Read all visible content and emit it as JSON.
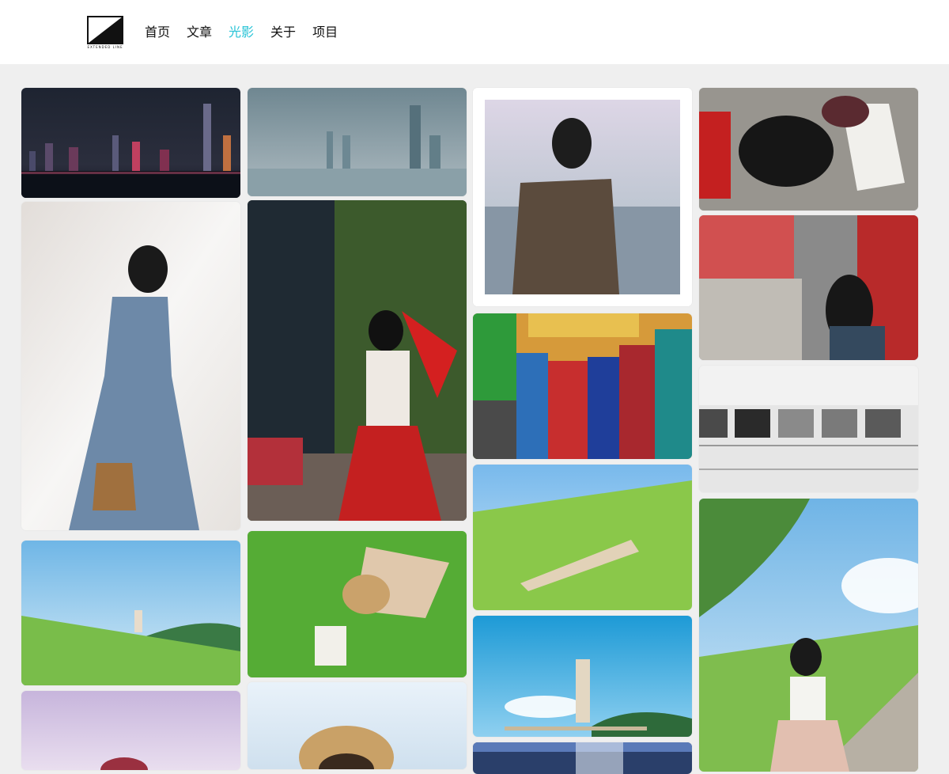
{
  "site": {
    "logo_text": "EXTENDED LINE",
    "nav": [
      {
        "label": "首页",
        "active": false
      },
      {
        "label": "文章",
        "active": false
      },
      {
        "label": "光影",
        "active": true
      },
      {
        "label": "关于",
        "active": false
      },
      {
        "label": "项目",
        "active": false
      }
    ]
  },
  "colors": {
    "accent": "#27c3d6",
    "page_bg": "#efefef",
    "header_bg": "#ffffff"
  },
  "gallery": {
    "photos": [
      {
        "name": "night-harbor-skyline-photo"
      },
      {
        "name": "foggy-harbor-skyline-photo"
      },
      {
        "name": "girl-by-harbor-photo"
      },
      {
        "name": "girl-red-ribbon-lying-photo"
      },
      {
        "name": "girl-blue-dress-wall-photo"
      },
      {
        "name": "girl-red-skirt-hedge-photo"
      },
      {
        "name": "colorful-building-courtyard-photo"
      },
      {
        "name": "girl-phone-red-building-photo"
      },
      {
        "name": "gallery-hall-bw-photo"
      },
      {
        "name": "girl-on-grass-hill-photo"
      },
      {
        "name": "girl-lying-grass-photo"
      },
      {
        "name": "girl-lying-hill-photo"
      },
      {
        "name": "girl-under-tree-hill-photo"
      },
      {
        "name": "girl-standing-blue-sky-photo"
      },
      {
        "name": "purple-portrait-photo"
      },
      {
        "name": "straw-hat-portrait-photo"
      },
      {
        "name": "city-lights-photo"
      }
    ]
  }
}
